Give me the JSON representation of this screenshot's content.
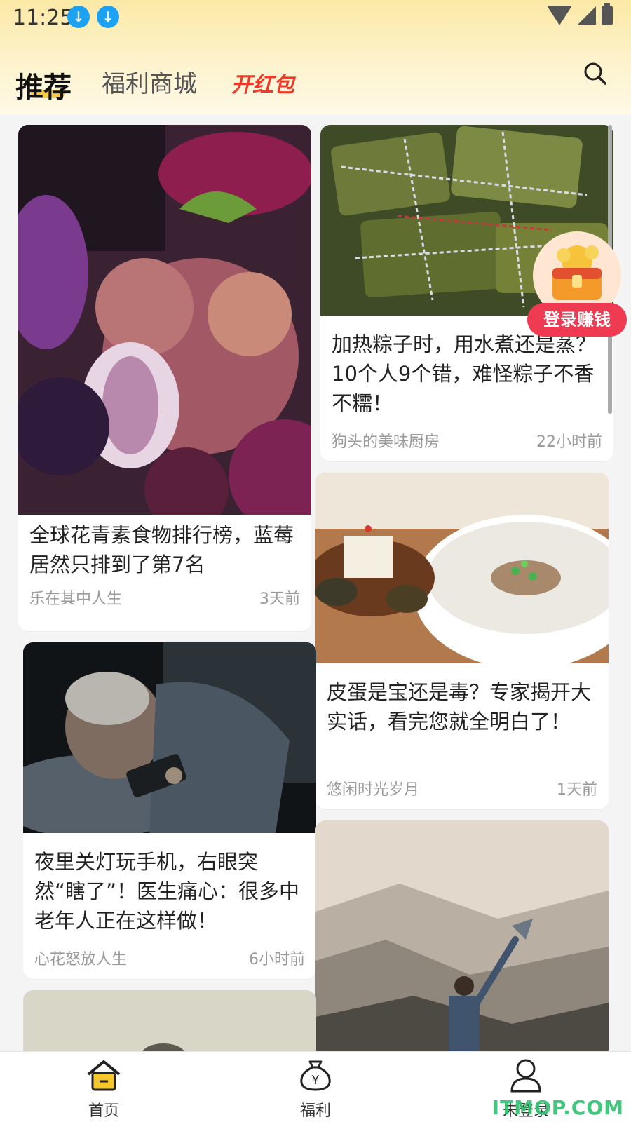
{
  "status_bar": {
    "time": "11:25",
    "icons": [
      "download-icon",
      "download-icon",
      "wifi-icon",
      "signal-icon",
      "battery-icon"
    ]
  },
  "tabs": [
    {
      "label": "推荐",
      "active": true
    },
    {
      "label": "福利商城",
      "active": false
    },
    {
      "label": "开红包",
      "active": false
    }
  ],
  "floating_badge": {
    "label": "登录赚钱"
  },
  "cards": [
    {
      "title": "全球花青素食物排行榜，蓝莓居然只排到了第7名",
      "author": "乐在其中人生",
      "time": "3天前"
    },
    {
      "title": "加热粽子时，用水煮还是蒸？10个人9个错，难怪粽子不香不糯！",
      "author": "狗头的美味厨房",
      "time": "22小时前"
    },
    {
      "title": "皮蛋是宝还是毒？专家揭开大实话，看完您就全明白了！",
      "author": "悠闲时光岁月",
      "time": "1天前"
    },
    {
      "title": "夜里关灯玩手机，右眼突然“瞎了”！医生痛心：很多中老年人正在这样做！",
      "author": "心花怒放人生",
      "time": "6小时前"
    }
  ],
  "bottom_nav": [
    {
      "label": "首页",
      "icon": "home-icon",
      "active": true
    },
    {
      "label": "福利",
      "icon": "money-bag-icon",
      "active": false
    },
    {
      "label": "未登录",
      "icon": "user-icon",
      "active": false
    }
  ],
  "watermark": "ITMOP.COM",
  "colors": {
    "accent": "#f2c22e",
    "redpack": "#ef3a2a",
    "badge": "#ee3b52"
  }
}
